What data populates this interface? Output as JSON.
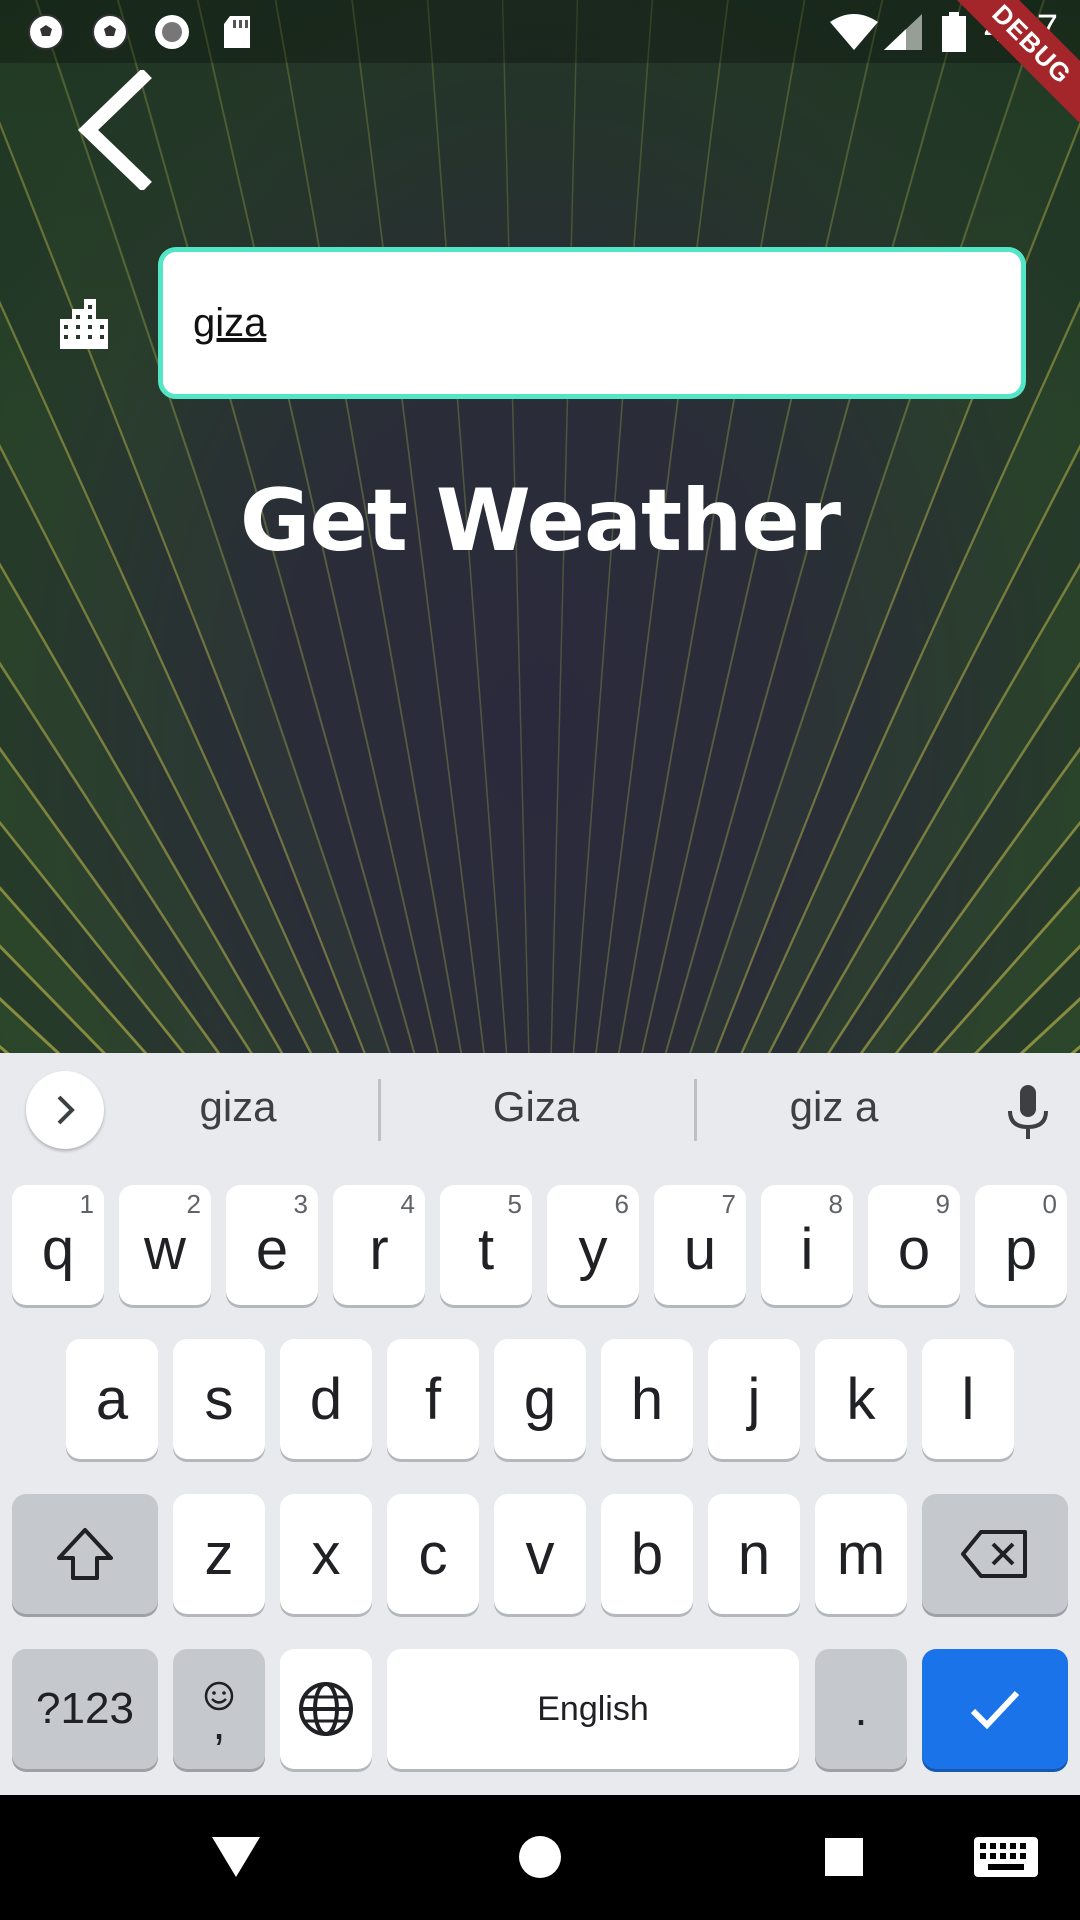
{
  "status_bar": {
    "time": "4:27",
    "debug_label": "DEBUG",
    "icons": [
      "soccer-ball-icon",
      "soccer-ball-icon",
      "record-icon",
      "sd-card-icon",
      "wifi-icon",
      "signal-icon",
      "battery-icon"
    ]
  },
  "app": {
    "back_icon": "chevron-left-icon",
    "city_icon": "city-buildings-icon",
    "city_input": {
      "value": "giza",
      "placeholder": ""
    },
    "get_weather_label": "Get Weather",
    "input_border_color": "#52e6c6"
  },
  "keyboard": {
    "suggestions": [
      "giza",
      "Giza",
      "giz a"
    ],
    "row1": [
      {
        "letter": "q",
        "hint": "1"
      },
      {
        "letter": "w",
        "hint": "2"
      },
      {
        "letter": "e",
        "hint": "3"
      },
      {
        "letter": "r",
        "hint": "4"
      },
      {
        "letter": "t",
        "hint": "5"
      },
      {
        "letter": "y",
        "hint": "6"
      },
      {
        "letter": "u",
        "hint": "7"
      },
      {
        "letter": "i",
        "hint": "8"
      },
      {
        "letter": "o",
        "hint": "9"
      },
      {
        "letter": "p",
        "hint": "0"
      }
    ],
    "row2": [
      "a",
      "s",
      "d",
      "f",
      "g",
      "h",
      "j",
      "k",
      "l"
    ],
    "row3": [
      "z",
      "x",
      "c",
      "v",
      "b",
      "n",
      "m"
    ],
    "symbols_label": "?123",
    "comma_label": ",",
    "space_label": "English",
    "period_label": ".",
    "enter_color": "#1a73e8"
  },
  "nav_bar": {
    "icons": [
      "back-triangle-icon",
      "home-circle-icon",
      "recents-square-icon",
      "keyboard-icon"
    ]
  }
}
